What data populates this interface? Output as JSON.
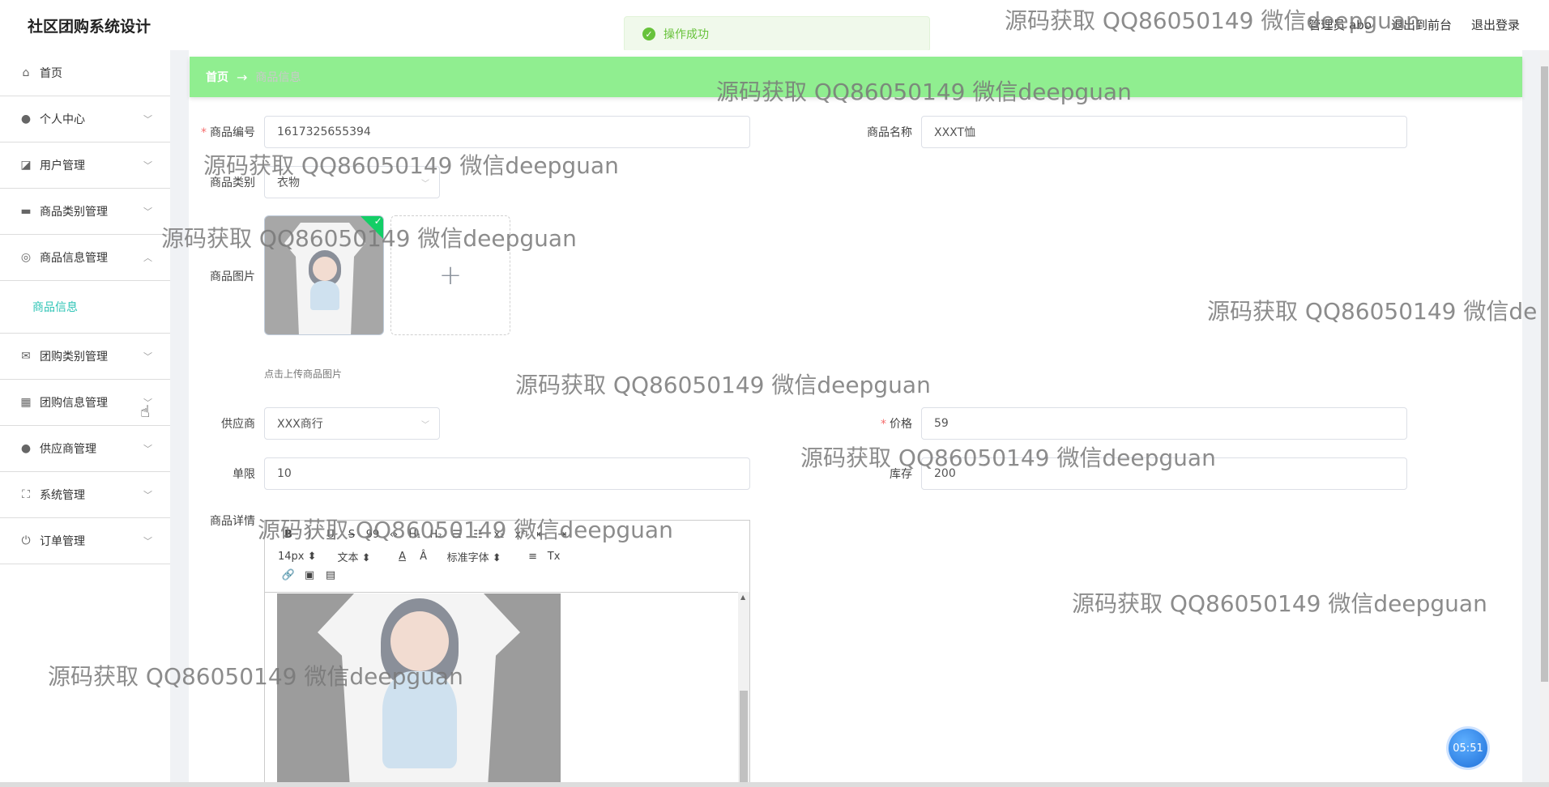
{
  "app": {
    "title": "社区团购系统设计"
  },
  "header": {
    "admin_label": "管理员 abo",
    "back_label": "退出到前台",
    "logout_label": "退出登录"
  },
  "toast": {
    "message": "操作成功"
  },
  "sidebar": {
    "items": [
      {
        "label": "首页",
        "icon": "home-icon"
      },
      {
        "label": "个人中心",
        "icon": "user-icon"
      },
      {
        "label": "用户管理",
        "icon": "chart-icon"
      },
      {
        "label": "商品类别管理",
        "icon": "briefcase-icon"
      },
      {
        "label": "商品信息管理",
        "icon": "target-icon"
      },
      {
        "label": "团购类别管理",
        "icon": "mail-icon"
      },
      {
        "label": "团购信息管理",
        "icon": "clipboard-icon"
      },
      {
        "label": "供应商管理",
        "icon": "user-icon"
      },
      {
        "label": "系统管理",
        "icon": "frame-icon"
      },
      {
        "label": "订单管理",
        "icon": "power-icon"
      }
    ],
    "submenu": {
      "label": "商品信息"
    }
  },
  "breadcrumb": {
    "home": "首页",
    "arrow": "→",
    "current": "商品信息"
  },
  "form": {
    "code_label": "商品编号",
    "code_value": "1617325655394",
    "name_label": "商品名称",
    "name_value": "XXXT恤",
    "category_label": "商品类别",
    "category_value": "衣物",
    "image_label": "商品图片",
    "upload_tip": "点击上传商品图片",
    "supplier_label": "供应商",
    "supplier_value": "XXX商行",
    "price_label": "价格",
    "price_value": "59",
    "limit_label": "单限",
    "limit_value": "10",
    "stock_label": "库存",
    "stock_value": "200",
    "detail_label": "商品详情"
  },
  "editor": {
    "font_size": "14px",
    "text_type": "文本",
    "font_family": "标准字体",
    "row1_buttons": [
      "B",
      "I",
      "U",
      "S",
      "99",
      "‹›",
      "H₁",
      "H₂",
      "☰",
      "☷",
      "x₂",
      "x²",
      "⇤",
      "⇥"
    ],
    "row2_buttons": [
      "A",
      "Â",
      "≡",
      "Tx"
    ],
    "row3_buttons": [
      "🔗",
      "▣",
      "▤"
    ]
  },
  "clock": "05:51",
  "watermark": "源码获取 QQ86050149 微信deepguan",
  "watermark_clipped": "源码获取 QQ86050149 微信de"
}
